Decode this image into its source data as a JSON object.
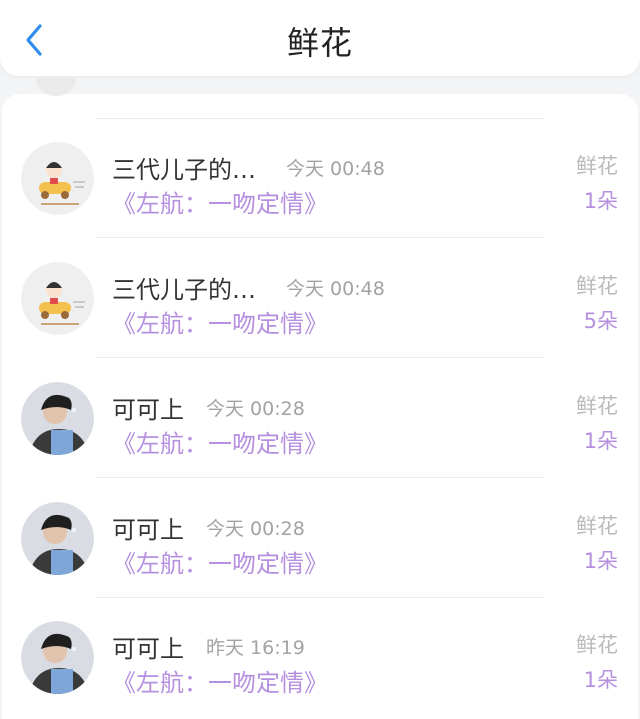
{
  "header": {
    "title": "鲜花",
    "back_icon": "chevron-left-icon",
    "accent_color": "#2e8ef0"
  },
  "list": {
    "items": [
      {
        "name": "三代儿子的…",
        "time": "今天 00:48",
        "book": "《左航：一吻定情》",
        "gift": "鲜花",
        "count": "1朵",
        "avatar": "cartoon-car-avatar"
      },
      {
        "name": "三代儿子的…",
        "time": "今天 00:48",
        "book": "《左航：一吻定情》",
        "gift": "鲜花",
        "count": "5朵",
        "avatar": "cartoon-car-avatar"
      },
      {
        "name": "可可上",
        "time": "今天 00:28",
        "book": "《左航：一吻定情》",
        "gift": "鲜花",
        "count": "1朵",
        "avatar": "person-photo-avatar"
      },
      {
        "name": "可可上",
        "time": "今天 00:28",
        "book": "《左航：一吻定情》",
        "gift": "鲜花",
        "count": "1朵",
        "avatar": "person-photo-avatar"
      },
      {
        "name": "可可上",
        "time": "昨天 16:19",
        "book": "《左航：一吻定情》",
        "gift": "鲜花",
        "count": "1朵",
        "avatar": "person-photo-avatar"
      }
    ]
  },
  "colors": {
    "purple_text": "#b690e0",
    "gray_text": "#a3a3a3",
    "background": "#f3f4f6"
  }
}
